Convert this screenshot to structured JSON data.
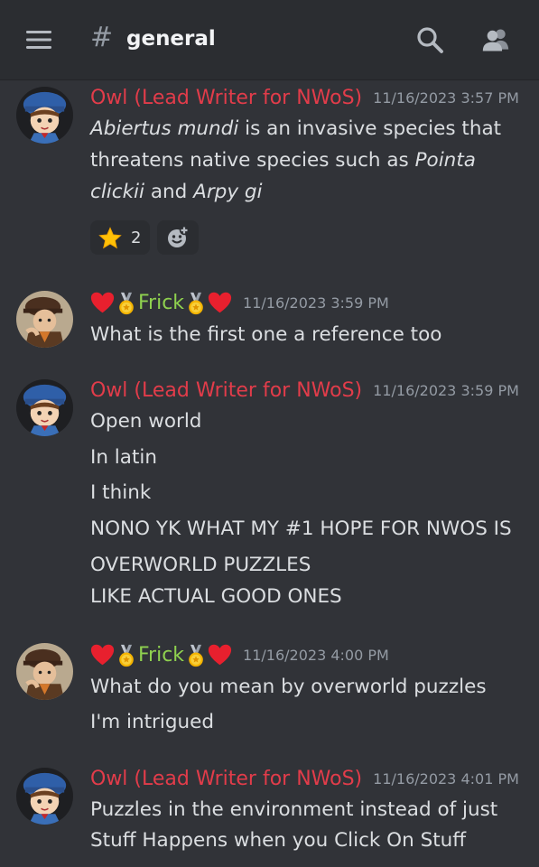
{
  "header": {
    "hash": "#",
    "channel": "general",
    "icons": [
      "menu-icon",
      "search-icon",
      "members-icon"
    ]
  },
  "colors": {
    "background": "#313338",
    "topbar": "#2b2d31",
    "owl_name": "#e23c4a",
    "frick_name": "#8fd14f",
    "timestamp": "#949ba4"
  },
  "messages": [
    {
      "author": "Owl (Lead Writer for NWoS)",
      "timestamp": "11/16/2023 3:57 PM",
      "line1_italic_a": "Abiertus mundi",
      "line1_rest": " is an invasive species that",
      "line2_plain": "threatens native species such as ",
      "line2_italic": "Pointa",
      "line3_italic_a": "clickii",
      "line3_plain": " and ",
      "line3_italic_b": "Arpy gi",
      "reaction": {
        "icon": "star-icon",
        "count": "2"
      }
    },
    {
      "author": "Frick",
      "timestamp": "11/16/2023 3:59 PM",
      "lines": [
        "What is the first one a reference too"
      ]
    },
    {
      "author": "Owl (Lead Writer for NWoS)",
      "timestamp": "11/16/2023 3:59 PM",
      "lines": [
        "Open world",
        "In latin",
        "I think",
        "NONO YK WHAT MY #1 HOPE FOR NWOS IS",
        "OVERWORLD PUZZLES",
        "LIKE ACTUAL GOOD ONES"
      ]
    },
    {
      "author": "Frick",
      "timestamp": "11/16/2023 4:00 PM",
      "lines": [
        "What do you mean by overworld puzzles",
        "I'm intrigued"
      ]
    },
    {
      "author": "Owl (Lead Writer for NWoS)",
      "timestamp": "11/16/2023 4:01 PM",
      "lines": [
        "Puzzles in the environment instead of just",
        "Stuff Happens when you Click On Stuff"
      ]
    }
  ]
}
